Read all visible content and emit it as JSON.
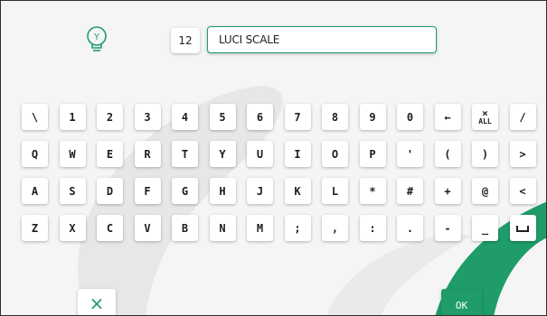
{
  "header": {
    "room_number": "12",
    "name_value": "LUCI SCALE",
    "icon": "lightbulb-icon",
    "icon_letter": "Y"
  },
  "keyboard": {
    "rows": [
      [
        "\\",
        "1",
        "2",
        "3",
        "4",
        "5",
        "6",
        "7",
        "8",
        "9",
        "0",
        "←",
        "ALL",
        "/"
      ],
      [
        "Q",
        "W",
        "E",
        "R",
        "T",
        "Y",
        "U",
        "I",
        "O",
        "P",
        "'",
        "(",
        ")",
        ">"
      ],
      [
        "A",
        "S",
        "D",
        "F",
        "G",
        "H",
        "J",
        "K",
        "L",
        "*",
        "#",
        "+",
        "@",
        "<"
      ],
      [
        "Z",
        "X",
        "C",
        "V",
        "B",
        "N",
        "M",
        ";",
        ",",
        ":",
        ".",
        "-",
        "_",
        "␣"
      ]
    ]
  },
  "actions": {
    "cancel_label": "×",
    "ok_label": "OK"
  },
  "colors": {
    "accent": "#1f9c6a",
    "background": "#f4f5f4",
    "swirl": "#e6e7e6"
  }
}
